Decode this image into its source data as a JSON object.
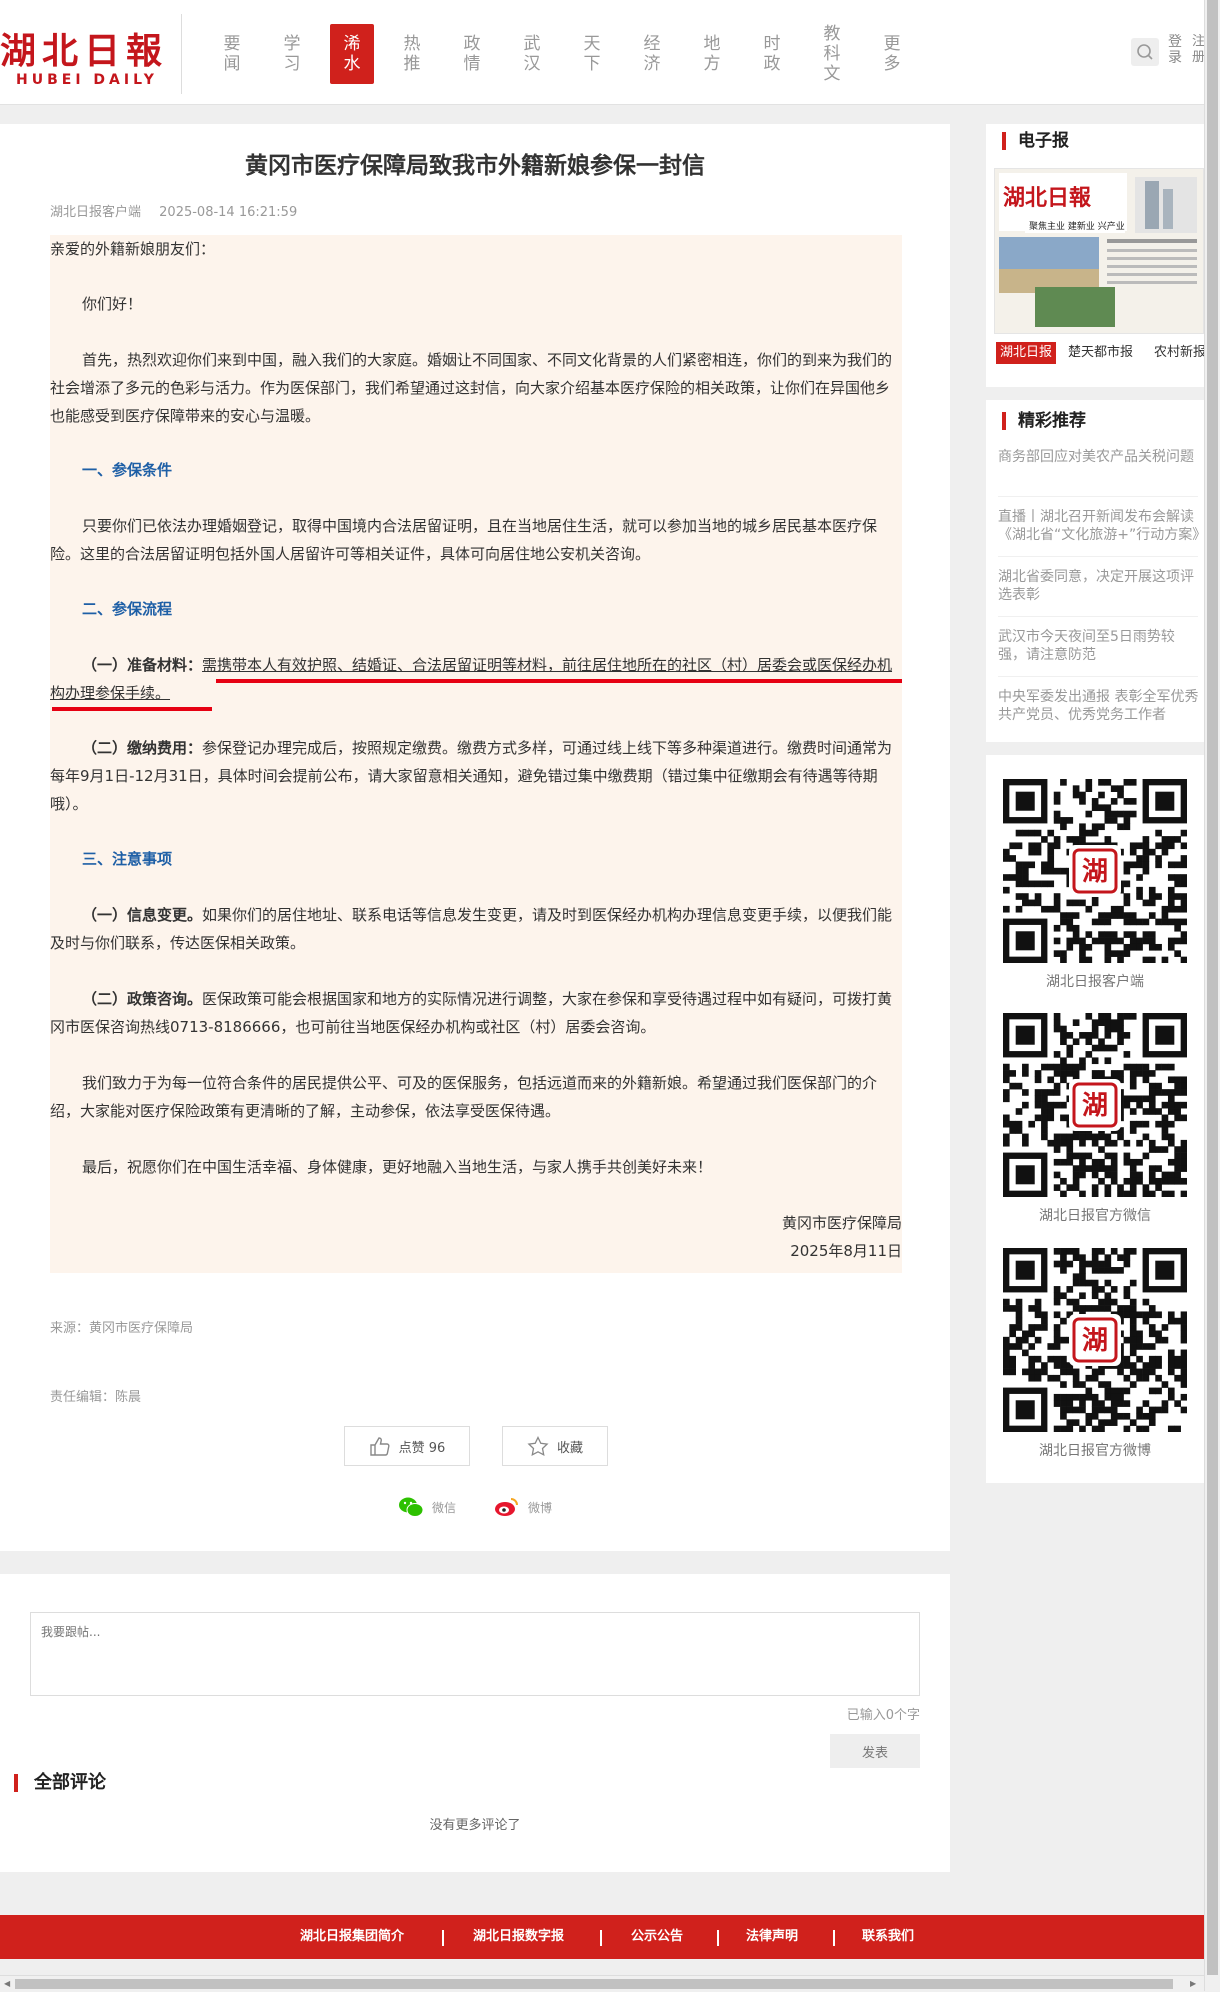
{
  "header": {
    "logo_cn": "湖北日報",
    "logo_en": "HUBEI  DAILY",
    "nav": [
      "要闻",
      "学习",
      "浠水",
      "热推",
      "政情",
      "武汉",
      "天下",
      "经济",
      "地方",
      "时政",
      "教科文",
      "更多"
    ],
    "active_nav": "浠水",
    "login": "登录",
    "register": "注册"
  },
  "article": {
    "title": "黄冈市医疗保障局致我市外籍新娘参保一封信",
    "source_label": "湖北日报客户端",
    "datetime": "2025-08-14 16:21:59",
    "salutation": "亲爱的外籍新娘朋友们：",
    "greeting": "你们好！",
    "intro": "首先，热烈欢迎你们来到中国，融入我们的大家庭。婚姻让不同国家、不同文化背景的人们紧密相连，你们的到来为我们的社会增添了多元的色彩与活力。作为医保部门，我们希望通过这封信，向大家介绍基本医疗保险的相关政策，让你们在异国他乡也能感受到医疗保障带来的安心与温暖。",
    "s1_title": "一、参保条件",
    "s1_text": "只要你们已依法办理婚姻登记，取得中国境内合法居留证明，且在当地居住生活，就可以参加当地的城乡居民基本医疗保险。这里的合法居留证明包括外国人居留许可等相关证件，具体可向居住地公安机关咨询。",
    "s2_title": "二、参保流程",
    "s2_p1_label": "（一）准备材料：",
    "s2_p1_text": "需携带本人有效护照、结婚证、合法居留证明等材料，前往居住地所在的社区（村）居委会或医保经办机构办理参保手续。",
    "s2_p2_label": "（二）缴纳费用：",
    "s2_p2_text": "参保登记办理完成后，按照规定缴费。缴费方式多样，可通过线上线下等多种渠道进行。缴费时间通常为每年9月1日-12月31日，具体时间会提前公布，请大家留意相关通知，避免错过集中缴费期（错过集中征缴期会有待遇等待期哦）。",
    "s3_title": "三、注意事项",
    "s3_p1_label": "（一）信息变更。",
    "s3_p1_text": "如果你们的居住地址、联系电话等信息发生变更，请及时到医保经办机构办理信息变更手续，以便我们能及时与你们联系，传达医保相关政策。",
    "s3_p2_label": "（二）政策咨询。",
    "s3_p2_text": "医保政策可能会根据国家和地方的实际情况进行调整，大家在参保和享受待遇过程中如有疑问，可拨打黄冈市医保咨询热线0713-8186666，也可前往当地医保经办机构或社区（村）居委会咨询。",
    "commit": "我们致力于为每一位符合条件的居民提供公平、可及的医保服务，包括远道而来的外籍新娘。希望通过我们医保部门的介绍，大家能对医疗保险政策有更清晰的了解，主动参保，依法享受医保待遇。",
    "closing": "最后，祝愿你们在中国生活幸福、身体健康，更好地融入当地生活，与家人携手共创美好未来！",
    "signature": "黄冈市医疗保障局",
    "sign_date": "2025年8月11日",
    "source": "来源：黄冈市医疗保障局",
    "editor": "责任编辑：陈晨",
    "like_label": "点赞 96",
    "fav_label": "收藏",
    "share_wechat": "微信",
    "share_weibo": "微博"
  },
  "comments": {
    "placeholder": "我要跟帖...",
    "counter": "已输入0个字",
    "submit": "发表",
    "title": "全部评论",
    "empty": "没有更多评论了"
  },
  "sidebar": {
    "epaper_title": "电子报",
    "epaper_header": "湖北日報",
    "epaper_headline": "聚焦主业 建新业 兴产业",
    "epaper_tabs": [
      "湖北日报",
      "楚天都市报",
      "农村新报"
    ],
    "rec_title": "精彩推荐",
    "recommendations": [
      "商务部回应对美农产品关税问题",
      "直播丨湖北召开新闻发布会解读《湖北省“文化旅游+”行动方案》",
      "湖北省委同意，决定开展这项评选表彰",
      "武汉市今天夜间至5日雨势较强，请注意防范",
      "中央军委发出通报 表彰全军优秀共产党员、优秀党务工作者"
    ],
    "qr": [
      {
        "label": "湖北日报客户端",
        "center": "湖"
      },
      {
        "label": "湖北日报官方微信",
        "center": "湖"
      },
      {
        "label": "湖北日报官方微博",
        "center": "湖"
      }
    ]
  },
  "footer": {
    "links": [
      "湖北日报集团简介",
      "湖北日报数字报",
      "公示公告",
      "法律声明",
      "联系我们"
    ]
  },
  "colors": {
    "brand_red": "#d0211c",
    "section_blue": "#1e5fa6",
    "letter_bg": "#fdf4ec",
    "underline_red": "#e60012"
  }
}
